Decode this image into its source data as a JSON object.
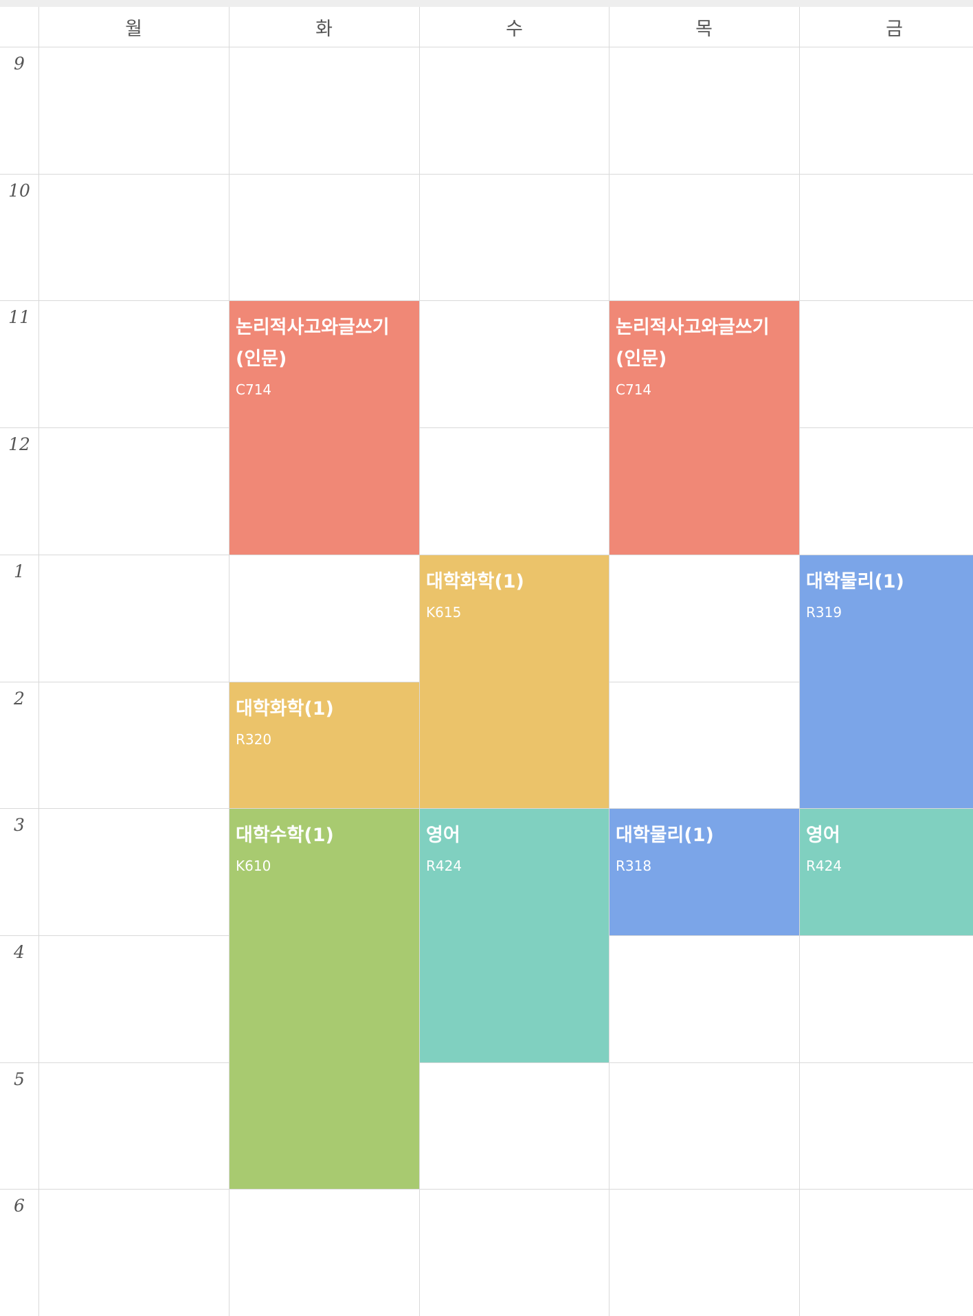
{
  "days": [
    "월",
    "화",
    "수",
    "목",
    "금"
  ],
  "hours": [
    "9",
    "10",
    "11",
    "12",
    "1",
    "2",
    "3",
    "4",
    "5",
    "6"
  ],
  "colors": {
    "red": "#F08876",
    "yellow": "#EBC36A",
    "blue": "#7BA5E8",
    "teal": "#80D0C0",
    "green": "#A8CA70"
  },
  "courses": [
    {
      "title": "논리적사고와글쓰기\n(인문)",
      "room": "C714",
      "day": 1,
      "start": 11,
      "end": 13,
      "color": "red"
    },
    {
      "title": "논리적사고와글쓰기\n(인문)",
      "room": "C714",
      "day": 3,
      "start": 11,
      "end": 13,
      "color": "red"
    },
    {
      "title": "대학화학(1)",
      "room": "K615",
      "day": 2,
      "start": 13,
      "end": 15,
      "color": "yellow"
    },
    {
      "title": "대학물리(1)",
      "room": "R319",
      "day": 4,
      "start": 13,
      "end": 15,
      "color": "blue"
    },
    {
      "title": "대학화학(1)",
      "room": "R320",
      "day": 1,
      "start": 14,
      "end": 15,
      "color": "yellow"
    },
    {
      "title": "대학수학(1)",
      "room": "K610",
      "day": 1,
      "start": 15,
      "end": 18,
      "color": "green"
    },
    {
      "title": "영어",
      "room": "R424",
      "day": 2,
      "start": 15,
      "end": 17,
      "color": "teal"
    },
    {
      "title": "대학물리(1)",
      "room": "R318",
      "day": 3,
      "start": 15,
      "end": 16,
      "color": "blue"
    },
    {
      "title": "영어",
      "room": "R424",
      "day": 4,
      "start": 15,
      "end": 16,
      "color": "teal"
    }
  ]
}
